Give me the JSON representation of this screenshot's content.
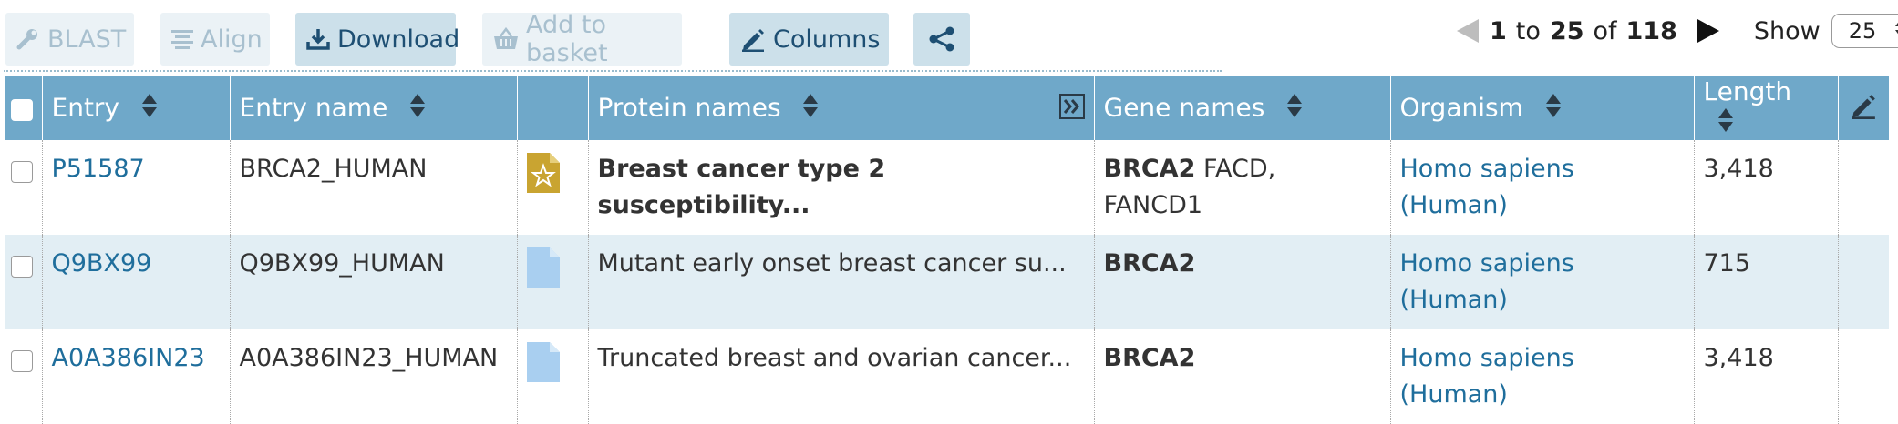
{
  "toolbar": {
    "blast_label": "BLAST",
    "align_label": "Align",
    "download_label": "Download",
    "basket_label": "Add to basket",
    "columns_label": "Columns",
    "share_icon": "share-icon"
  },
  "pagination": {
    "from": "1",
    "to_word": "to",
    "to": "25",
    "of_word": "of",
    "total": "118",
    "show_label": "Show",
    "page_size": "25"
  },
  "table": {
    "headers": {
      "entry": "Entry",
      "entry_name": "Entry name",
      "protein_names": "Protein names",
      "gene_names": "Gene names",
      "organism": "Organism",
      "length": "Length"
    },
    "rows": [
      {
        "entry": "P51587",
        "entry_name": "BRCA2_HUMAN",
        "status": "reviewed",
        "protein_name": "Breast cancer type 2 susceptibility...",
        "gene_primary": "BRCA2",
        "gene_synonyms": "FACD, FANCD1",
        "organism": "Homo sapiens (Human)",
        "length": "3,418"
      },
      {
        "entry": "Q9BX99",
        "entry_name": "Q9BX99_HUMAN",
        "status": "unreviewed",
        "protein_name": "Mutant early onset breast cancer su...",
        "gene_primary": "BRCA2",
        "gene_synonyms": "",
        "organism": "Homo sapiens (Human)",
        "length": "715"
      },
      {
        "entry": "A0A386IN23",
        "entry_name": "A0A386IN23_HUMAN",
        "status": "unreviewed",
        "protein_name": "Truncated breast and ovarian cancer...",
        "gene_primary": "BRCA2",
        "gene_synonyms": "",
        "organism": "Homo sapiens (Human)",
        "length": "3,418"
      }
    ]
  },
  "colors": {
    "header_bg": "#6fa8c9",
    "link": "#1f6e9c",
    "stripe": "#e2eef4",
    "reviewed_icon": "#c9a431",
    "unreviewed_icon": "#a9cff0"
  }
}
